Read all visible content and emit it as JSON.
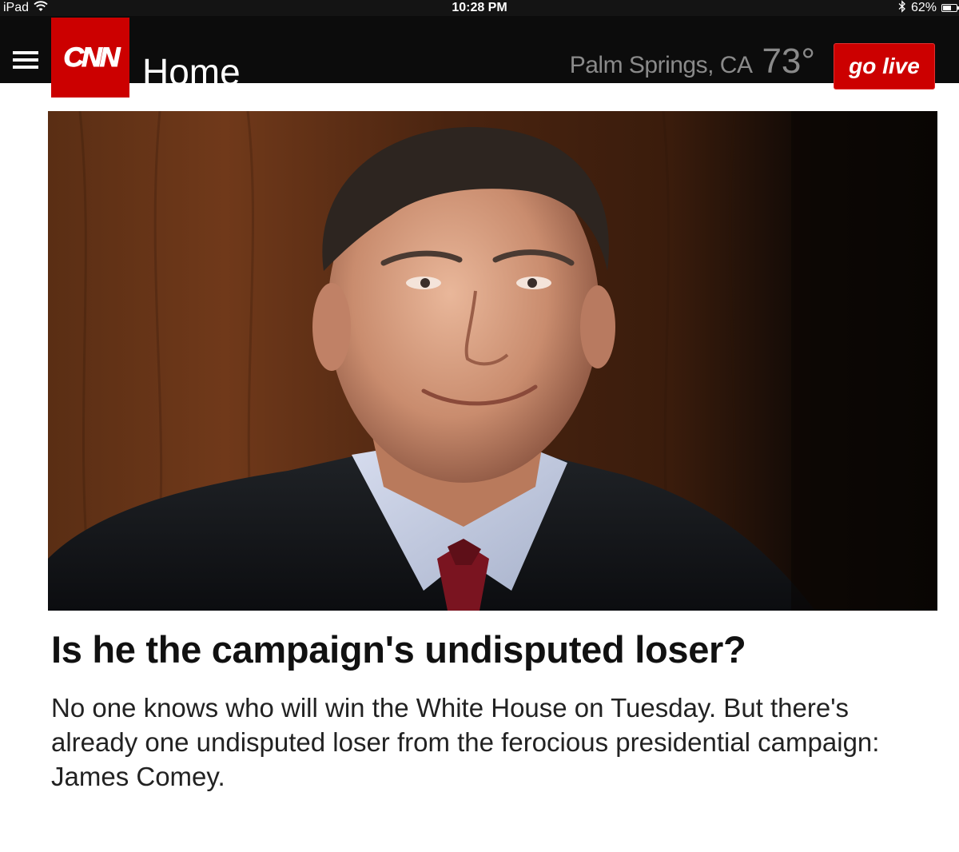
{
  "status_bar": {
    "device": "iPad",
    "time": "10:28 PM",
    "battery_percent": "62%",
    "battery_level": 0.62,
    "icons": [
      "wifi-icon",
      "bluetooth-icon",
      "battery-icon"
    ]
  },
  "header": {
    "logo_text": "CNN",
    "section_title": "Home",
    "weather": {
      "location": "Palm Springs, CA",
      "temperature": "73°"
    },
    "go_live_label": "go live",
    "menu_icon": "hamburger-menu-icon"
  },
  "article": {
    "headline": "Is he the campaign's undisputed loser?",
    "summary": "No one knows who will win the White House on Tuesday. But there's already one undisputed loser from the ferocious presidential campaign: James Comey."
  },
  "colors": {
    "brand_red": "#cc0000",
    "header_bg": "#0c0c0c",
    "weather_gray": "#8a8a8a"
  }
}
